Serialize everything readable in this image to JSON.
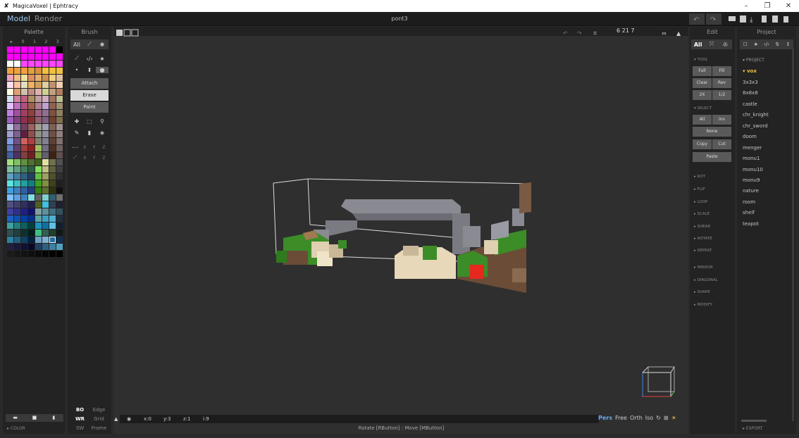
{
  "window": {
    "title": "MagicaVoxel | Ephtracy",
    "min": "–",
    "restore": "❐",
    "close": "✕"
  },
  "menubar": {
    "model": "Model",
    "render": "Render",
    "file_name": "pont3"
  },
  "palette": {
    "title": "Palette",
    "tabs": [
      "▸",
      "0",
      "1",
      "2",
      "3"
    ],
    "bottom_icons": [
      "folder-icon",
      "save-icon",
      "file-icon"
    ],
    "color_section": "▸ COLOR",
    "colors": [
      "#ff00ff",
      "#ff00ff",
      "#ff00ff",
      "#ff00ff",
      "#ff00ff",
      "#ff00ff",
      "#ff00ff",
      "#000000",
      "#ff00ff",
      "#ff00ff",
      "#ff00ff",
      "#ff00ff",
      "#ff00ff",
      "#ff00ff",
      "#ff00ff",
      "#ff00ff",
      "#ffffff",
      "#ffffff",
      "#ff44ff",
      "#ff44ff",
      "#ff44ff",
      "#ff44ff",
      "#ff44ff",
      "#ff44ff",
      "#f0a040",
      "#f0a040",
      "#f0a040",
      "#e0a040",
      "#d89040",
      "#f0c040",
      "#f0c040",
      "#f0c040",
      "#f0a0c0",
      "#f0c080",
      "#f0e0a0",
      "#e09060",
      "#e0b070",
      "#d09050",
      "#f0d080",
      "#e0c0a0",
      "#ffe0f0",
      "#ffc0a0",
      "#e0e0c0",
      "#f0b060",
      "#d0a060",
      "#e0d0a0",
      "#c09070",
      "#f0d0b0",
      "#ffffe0",
      "#e0a070",
      "#d0c0b0",
      "#c09080",
      "#e0b0b0",
      "#d0d090",
      "#c0a080",
      "#b08060",
      "#d0e0f0",
      "#d080a0",
      "#c06080",
      "#b09060",
      "#c0a0a0",
      "#d0b0c0",
      "#a07060",
      "#c0c090",
      "#e0c0ff",
      "#c070c0",
      "#b05080",
      "#a06050",
      "#b08090",
      "#c0a0d0",
      "#906050",
      "#a09070",
      "#c080e0",
      "#a050a0",
      "#a04060",
      "#904040",
      "#a06080",
      "#907090",
      "#805040",
      "#908060",
      "#a060c0",
      "#804080",
      "#903050",
      "#803030",
      "#906070",
      "#806080",
      "#704030",
      "#807050",
      "#c0c0e0",
      "#9070a0",
      "#704060",
      "#a06060",
      "#a0a090",
      "#a0a0b0",
      "#806050",
      "#a09090",
      "#a0a0d0",
      "#806090",
      "#602040",
      "#905050",
      "#909080",
      "#9090a0",
      "#705040",
      "#908080",
      "#80a0e0",
      "#705080",
      "#d06060",
      "#b04040",
      "#808070",
      "#808090",
      "#604030",
      "#807070",
      "#6080c0",
      "#604070",
      "#a04040",
      "#902020",
      "#a0c060",
      "#707080",
      "#503020",
      "#706060",
      "#4060a0",
      "#503060",
      "#804040",
      "#702020",
      "#80a040",
      "#606070",
      "#402010",
      "#605050",
      "#a0e080",
      "#80c060",
      "#609040",
      "#507030",
      "#406020",
      "#e0e0a0",
      "#707050",
      "#505050",
      "#80c0a0",
      "#60a080",
      "#408060",
      "#306040",
      "#80e060",
      "#c0c080",
      "#606040",
      "#404040",
      "#60a0c0",
      "#4080a0",
      "#306080",
      "#204060",
      "#60c040",
      "#a0a060",
      "#505030",
      "#303030",
      "#60e0e0",
      "#40c0c0",
      "#20a0a0",
      "#108080",
      "#40a020",
      "#809040",
      "#404020",
      "#202020",
      "#40a0e0",
      "#4080c0",
      "#3060a0",
      "#204080",
      "#308010",
      "#607030",
      "#303010",
      "#101010",
      "#80c0ff",
      "#60a0e0",
      "#4080c0",
      "#80e0e0",
      "#606060",
      "#80d0d0",
      "#306070",
      "#707070",
      "#505080",
      "#404070",
      "#303060",
      "#202050",
      "#506020",
      "#40c0e0",
      "#304050",
      "#202030",
      "#4040a0",
      "#303090",
      "#202080",
      "#101070",
      "#80a0a0",
      "#6090a0",
      "#407080",
      "#305060",
      "#2060c0",
      "#1050b0",
      "#0040a0",
      "#003090",
      "#60a0a0",
      "#40a0c0",
      "#50b0d0",
      "#203040",
      "#40a0a0",
      "#208080",
      "#106060",
      "#004040",
      "#2090c0",
      "#1070a0",
      "#60c0e0",
      "#102030",
      "#305050",
      "#204040",
      "#103030",
      "#002020",
      "#40c080",
      "#306050",
      "#204030",
      "#101818",
      "#3080a0",
      "#206080",
      "#104060",
      "#002040",
      "#70a0c0",
      "#80b0d0",
      "#2070a0",
      "#103050",
      "#202040",
      "#181838",
      "#101030",
      "#080828",
      "#204060",
      "#306080",
      "#4080a0",
      "#50a0c0",
      "#1a1a1a",
      "#161616",
      "#121212",
      "#0e0e0e",
      "#0a0a0a",
      "#060606",
      "#030303",
      "#000000"
    ],
    "selected_index": 222
  },
  "brush": {
    "title": "Brush",
    "filter_all": "All",
    "modes": [
      "Attach",
      "Erase",
      "Paint"
    ],
    "axis1": [
      "X",
      "Y",
      "Z"
    ],
    "axis2": [
      "X",
      "Y",
      "Z"
    ],
    "bottom": [
      [
        "BO",
        "Edge"
      ],
      [
        "WR",
        "Grid"
      ],
      [
        "SW",
        "Frame"
      ]
    ]
  },
  "viewport": {
    "coords": "6 21 7",
    "status": {
      "x": "x:0",
      "y": "y:3",
      "z": "z:1",
      "i": "i:9"
    },
    "views": [
      "Pers",
      "Free",
      "Orth",
      "Iso"
    ],
    "hint": "Rotate [RButton] : Move [MButton]"
  },
  "edit": {
    "title": "Edit",
    "filter_all": "All",
    "tool_section": "▾ TOOL",
    "tool_buttons": [
      [
        "Full",
        "Fill"
      ],
      [
        "Clear",
        "Rev"
      ],
      [
        "2X",
        "1/2"
      ]
    ],
    "select_section": "▾ SELECT",
    "select_buttons": [
      [
        "All",
        "Inv"
      ]
    ],
    "select_none": "None",
    "clip_buttons": [
      [
        "Copy",
        "Cut"
      ]
    ],
    "paste": "Paste",
    "sections": [
      "▸ ROT",
      "▸ FLIP",
      "▸ LOOP",
      "▸ SCALE",
      "▸ SHEAR",
      "▸ ROTATE",
      "▸ REPEAT",
      "▸ MIRROR",
      "▸ DIAGONAL",
      "▸ SHAPE",
      "▸ MODIFY"
    ]
  },
  "project": {
    "title": "Project",
    "section": "▾ PROJECT",
    "items": [
      "▾ vox",
      "3x3x3",
      "8x8x8",
      "castle",
      "chr_knight",
      "chr_sword",
      "doom",
      "menger",
      "monu1",
      "monu10",
      "monu9",
      "nature",
      "room",
      "shelf",
      "teapot"
    ],
    "selected": "▾ vox",
    "export": "▸ EXPORT"
  },
  "colors": {
    "accent": "#9cc4ee",
    "selected_item": "#f0c040",
    "button": "#5a5a5a",
    "view_active": "#6aa8f0"
  }
}
